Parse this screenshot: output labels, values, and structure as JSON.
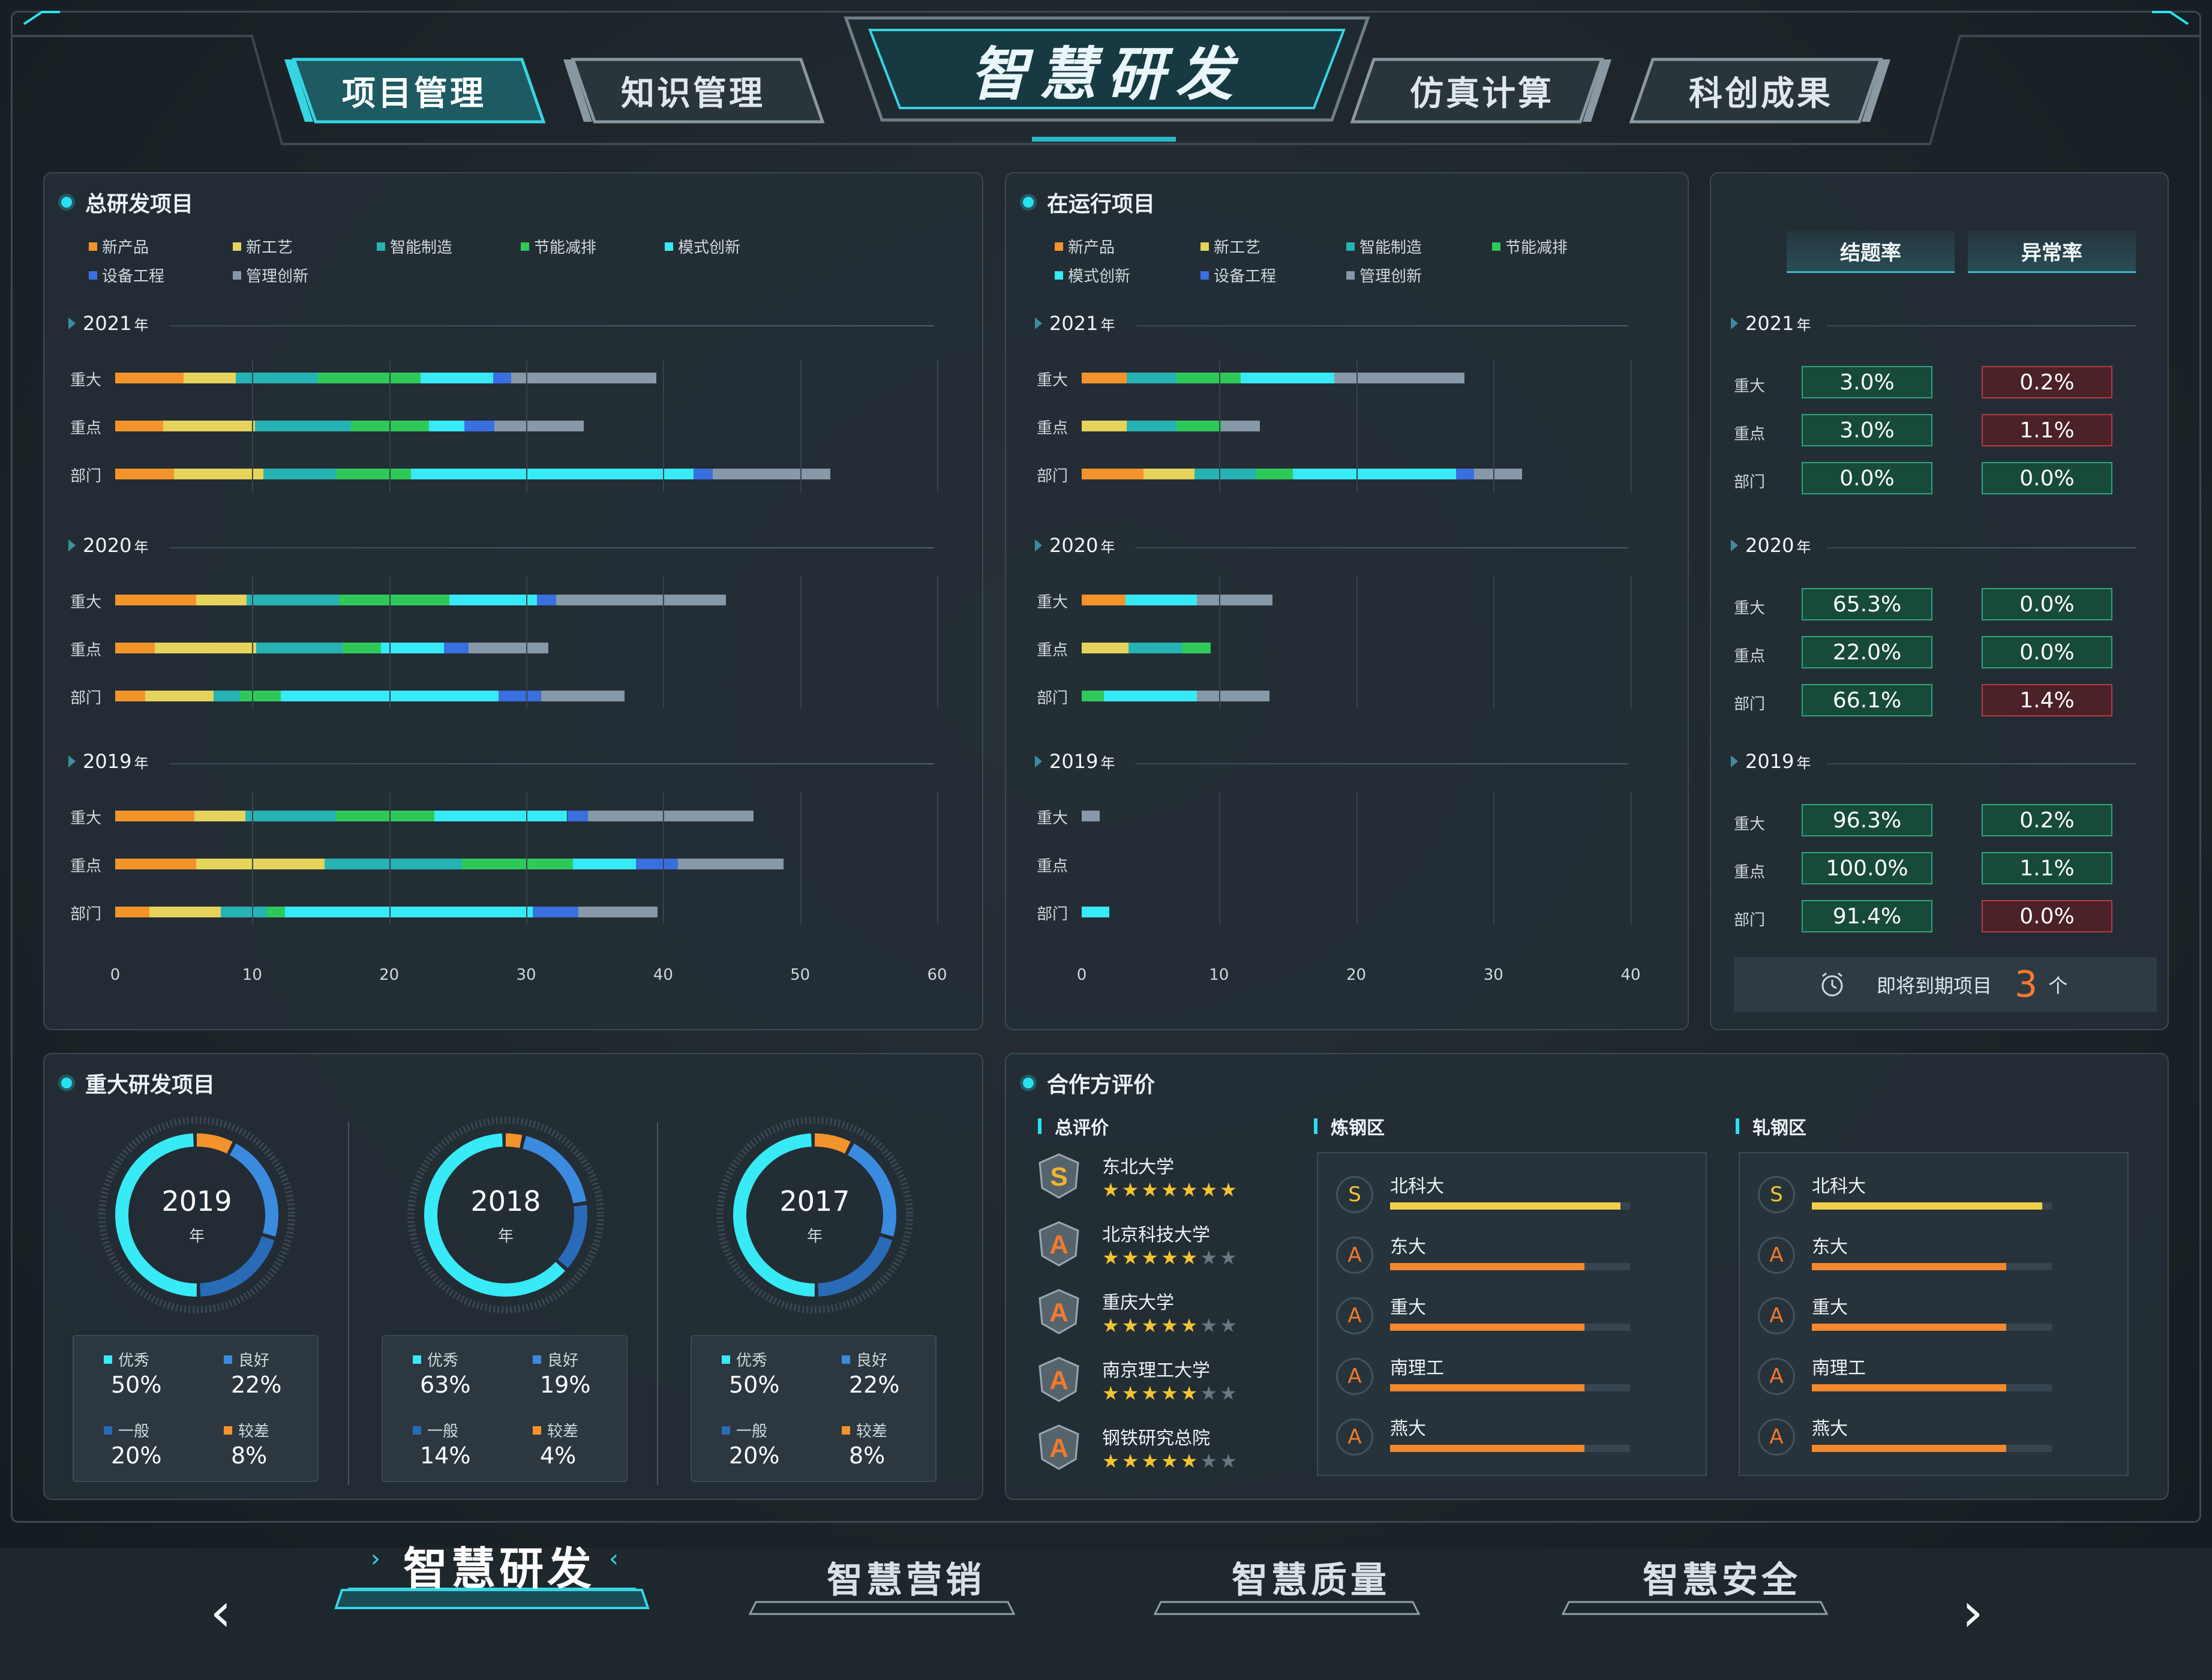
{
  "header": {
    "title": "智慧研发",
    "tabs": [
      {
        "label": "项目管理",
        "active": true
      },
      {
        "label": "知识管理",
        "active": false
      },
      {
        "label": "仿真计算",
        "active": false
      },
      {
        "label": "科创成果",
        "active": false
      }
    ]
  },
  "legend_categories": [
    "新产品",
    "新工艺",
    "智能制造",
    "节能减排",
    "模式创新",
    "设备工程",
    "管理创新"
  ],
  "category_colors": {
    "新产品": "#f3932b",
    "新工艺": "#e5d35b",
    "智能制造": "#27b3b3",
    "节能减排": "#2fc95a",
    "模式创新": "#37eaf6",
    "设备工程": "#3a6fe0",
    "管理创新": "#8799a8"
  },
  "year_suffix": "年",
  "total_projects": {
    "title": "总研发项目",
    "legend": [
      "新产品",
      "新工艺",
      "智能制造",
      "节能减排",
      "模式创新",
      "设备工程",
      "管理创新"
    ],
    "chart_data": {
      "type": "bar",
      "orientation": "horizontal-stacked",
      "x_ticks": [
        "0",
        "10",
        "20",
        "30",
        "40",
        "50",
        "60"
      ],
      "xlim": [
        0,
        60
      ],
      "groups": [
        {
          "year": "2021",
          "rows": [
            {
              "label": "重大",
              "values": {
                "新产品": 5,
                "新工艺": 3.8,
                "智能制造": 6,
                "节能减排": 7.5,
                "模式创新": 5.3,
                "设备工程": 1.3,
                "管理创新": 10.6
              }
            },
            {
              "label": "重点",
              "values": {
                "新产品": 3.5,
                "新工艺": 6.7,
                "智能制造": 7,
                "节能减排": 5.7,
                "模式创新": 2.6,
                "设备工程": 2.2,
                "管理创新": 6.5
              }
            },
            {
              "label": "部门",
              "values": {
                "新产品": 4.3,
                "新工艺": 6.5,
                "智能制造": 5.3,
                "节能减排": 5.5,
                "模式创新": 20.6,
                "设备工程": 1.4,
                "管理创新": 8.6
              }
            }
          ]
        },
        {
          "year": "2020",
          "rows": [
            {
              "label": "重大",
              "values": {
                "新产品": 5.9,
                "新工艺": 3.7,
                "智能制造": 6.8,
                "节能减排": 8,
                "模式创新": 6.4,
                "设备工程": 1.4,
                "管理创新": 12.4
              }
            },
            {
              "label": "重点",
              "values": {
                "新产品": 2.9,
                "新工艺": 7.4,
                "智能制造": 6.3,
                "节能减排": 2.8,
                "模式创新": 4.6,
                "设备工程": 1.8,
                "管理创新": 5.8
              }
            },
            {
              "label": "部门",
              "values": {
                "新产品": 2.2,
                "新工艺": 5,
                "智能制造": 1.9,
                "节能减排": 3,
                "模式创新": 15.9,
                "设备工程": 3.1,
                "管理创新": 6.1
              }
            }
          ]
        },
        {
          "year": "2019",
          "rows": [
            {
              "label": "重大",
              "values": {
                "新产品": 5.8,
                "新工艺": 3.7,
                "智能制造": 6.6,
                "节能减排": 7.2,
                "模式创新": 9.7,
                "设备工程": 1.5,
                "管理创新": 12.1
              }
            },
            {
              "label": "重点",
              "values": {
                "新产品": 5.9,
                "新工艺": 9.4,
                "智能制造": 10,
                "节能减排": 8.1,
                "模式创新": 4.6,
                "设备工程": 3.1,
                "管理创新": 7.7
              }
            },
            {
              "label": "部门",
              "values": {
                "新产品": 2.5,
                "新工艺": 5.2,
                "智能制造": 3.4,
                "节能减排": 1.3,
                "模式创新": 18.1,
                "设备工程": 3.3,
                "管理创新": 5.8
              }
            }
          ]
        }
      ]
    }
  },
  "running_projects": {
    "title": "在运行项目",
    "legend": [
      "新产品",
      "新工艺",
      "智能制造",
      "节能减排",
      "模式创新",
      "设备工程",
      "管理创新"
    ],
    "chart_data": {
      "type": "bar",
      "orientation": "horizontal-stacked",
      "x_ticks": [
        "0",
        "10",
        "20",
        "30",
        "40"
      ],
      "xlim": [
        0,
        40
      ],
      "groups": [
        {
          "year": "2021",
          "rows": [
            {
              "label": "重大",
              "values": {
                "新产品": 3.3,
                "新工艺": 0,
                "智能制造": 3.6,
                "节能减排": 4.7,
                "模式创新": 6.8,
                "设备工程": 0,
                "管理创新": 9.5
              }
            },
            {
              "label": "重点",
              "values": {
                "新产品": 0,
                "新工艺": 3.3,
                "智能制造": 3.6,
                "节能减排": 3.3,
                "模式创新": 0,
                "设备工程": 0,
                "管理创新": 2.8
              }
            },
            {
              "label": "部门",
              "values": {
                "新产品": 4.5,
                "新工艺": 3.7,
                "智能制造": 4.5,
                "节能减排": 2.7,
                "模式创新": 11.9,
                "设备工程": 1.3,
                "管理创新": 3.5
              }
            }
          ]
        },
        {
          "year": "2020",
          "rows": [
            {
              "label": "重大",
              "values": {
                "新产品": 3.2,
                "新工艺": 0,
                "智能制造": 0,
                "节能减排": 0,
                "模式创新": 5.2,
                "设备工程": 0,
                "管理创新": 5.5
              }
            },
            {
              "label": "重点",
              "values": {
                "新产品": 0,
                "新工艺": 3.4,
                "智能制造": 3.9,
                "节能减排": 2.1,
                "模式创新": 0,
                "设备工程": 0,
                "管理创新": 0
              }
            },
            {
              "label": "部门",
              "values": {
                "新产品": 0,
                "新工艺": 0,
                "智能制造": 0,
                "节能减排": 1.6,
                "模式创新": 6.8,
                "设备工程": 0,
                "管理创新": 5.3
              }
            }
          ]
        },
        {
          "year": "2019",
          "rows": [
            {
              "label": "重大",
              "values": {
                "新产品": 0,
                "新工艺": 0,
                "智能制造": 0,
                "节能减排": 0,
                "模式创新": 0,
                "设备工程": 0,
                "管理创新": 1.3
              }
            },
            {
              "label": "重点",
              "values": {
                "新产品": 0,
                "新工艺": 0,
                "智能制造": 0,
                "节能减排": 0,
                "模式创新": 0,
                "设备工程": 0,
                "管理创新": 0
              }
            },
            {
              "label": "部门",
              "values": {
                "新产品": 0,
                "新工艺": 0,
                "智能制造": 0,
                "节能减排": 0,
                "模式创新": 2,
                "设备工程": 0,
                "管理创新": 0
              }
            }
          ]
        }
      ]
    }
  },
  "rates": {
    "headers": [
      "结题率",
      "异常率"
    ],
    "years": [
      {
        "year": "2021",
        "rows": [
          {
            "label": "重大",
            "completion": "3.0%",
            "abnormal": "0.2%",
            "completion_status": "good",
            "abnormal_status": "bad"
          },
          {
            "label": "重点",
            "completion": "3.0%",
            "abnormal": "1.1%",
            "completion_status": "good",
            "abnormal_status": "bad"
          },
          {
            "label": "部门",
            "completion": "0.0%",
            "abnormal": "0.0%",
            "completion_status": "good",
            "abnormal_status": "good"
          }
        ]
      },
      {
        "year": "2020",
        "rows": [
          {
            "label": "重大",
            "completion": "65.3%",
            "abnormal": "0.0%",
            "completion_status": "good",
            "abnormal_status": "good"
          },
          {
            "label": "重点",
            "completion": "22.0%",
            "abnormal": "0.0%",
            "completion_status": "good",
            "abnormal_status": "good"
          },
          {
            "label": "部门",
            "completion": "66.1%",
            "abnormal": "1.4%",
            "completion_status": "good",
            "abnormal_status": "bad"
          }
        ]
      },
      {
        "year": "2019",
        "rows": [
          {
            "label": "重大",
            "completion": "96.3%",
            "abnormal": "0.2%",
            "completion_status": "good",
            "abnormal_status": "good"
          },
          {
            "label": "重点",
            "completion": "100.0%",
            "abnormal": "1.1%",
            "completion_status": "good",
            "abnormal_status": "good"
          },
          {
            "label": "部门",
            "completion": "91.4%",
            "abnormal": "0.0%",
            "completion_status": "good",
            "abnormal_status": "bad"
          }
        ]
      }
    ],
    "expiring": {
      "label": "即将到期项目",
      "count": "3",
      "unit": "个",
      "icon": "alarm-clock-icon"
    }
  },
  "major_projects": {
    "title": "重大研发项目",
    "grade_colors": {
      "优秀": "#37eaf6",
      "良好": "#3a8be0",
      "一般": "#2a6bb8",
      "较差": "#f3932b"
    },
    "donuts": [
      {
        "year": "2019",
        "unit": "年",
        "stats": [
          {
            "label": "优秀",
            "value": "50%"
          },
          {
            "label": "良好",
            "value": "22%"
          },
          {
            "label": "一般",
            "value": "20%"
          },
          {
            "label": "较差",
            "value": "8%"
          }
        ]
      },
      {
        "year": "2018",
        "unit": "年",
        "stats": [
          {
            "label": "优秀",
            "value": "63%"
          },
          {
            "label": "良好",
            "value": "19%"
          },
          {
            "label": "一般",
            "value": "14%"
          },
          {
            "label": "较差",
            "value": "4%"
          }
        ]
      },
      {
        "year": "2017",
        "unit": "年",
        "stats": [
          {
            "label": "优秀",
            "value": "50%"
          },
          {
            "label": "良好",
            "value": "22%"
          },
          {
            "label": "一般",
            "value": "20%"
          },
          {
            "label": "较差",
            "value": "8%"
          }
        ]
      }
    ]
  },
  "partner_eval": {
    "title": "合作方评价",
    "overall": {
      "label": "总评价",
      "items": [
        {
          "grade": "S",
          "name": "东北大学",
          "stars": 7,
          "max_stars": 7
        },
        {
          "grade": "A",
          "name": "北京科技大学",
          "stars": 5,
          "max_stars": 7
        },
        {
          "grade": "A",
          "name": "重庆大学",
          "stars": 5,
          "max_stars": 7
        },
        {
          "grade": "A",
          "name": "南京理工大学",
          "stars": 5,
          "max_stars": 7
        },
        {
          "grade": "A",
          "name": "钢铁研究总院",
          "stars": 5,
          "max_stars": 7
        }
      ]
    },
    "steelmaking": {
      "label": "炼钢区",
      "items": [
        {
          "grade": "S",
          "name": "北科大",
          "score": 0.96
        },
        {
          "grade": "A",
          "name": "东大",
          "score": 0.81
        },
        {
          "grade": "A",
          "name": "重大",
          "score": 0.81
        },
        {
          "grade": "A",
          "name": "南理工",
          "score": 0.81
        },
        {
          "grade": "A",
          "name": "燕大",
          "score": 0.81
        }
      ]
    },
    "rolling": {
      "label": "轧钢区",
      "items": [
        {
          "grade": "S",
          "name": "北科大",
          "score": 0.96
        },
        {
          "grade": "A",
          "name": "东大",
          "score": 0.81
        },
        {
          "grade": "A",
          "name": "重大",
          "score": 0.81
        },
        {
          "grade": "A",
          "name": "南理工",
          "score": 0.81
        },
        {
          "grade": "A",
          "name": "燕大",
          "score": 0.81
        }
      ]
    }
  },
  "bottom_nav": {
    "items": [
      {
        "label": "智慧研发",
        "active": true
      },
      {
        "label": "智慧营销",
        "active": false
      },
      {
        "label": "智慧质量",
        "active": false
      },
      {
        "label": "智慧安全",
        "active": false
      }
    ],
    "prev_icon": "chevron-left-icon",
    "next_icon": "chevron-right-icon"
  }
}
